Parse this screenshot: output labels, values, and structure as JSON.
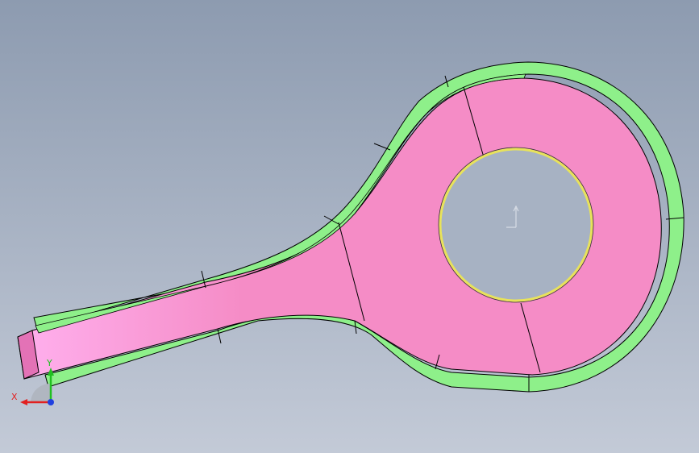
{
  "viewport": {
    "background_top": "#8d9bb0",
    "background_bottom": "#c3cad7"
  },
  "part": {
    "face_color": "#f58cc6",
    "face_highlight": "#ffb0ee",
    "side_color": "#e372b6",
    "rim_color": "#8ef08a",
    "rim_shadow": "#5fbf5c",
    "edge_color": "#000000",
    "hole_edge_color": "#e8e35a",
    "hole_fill": "#a7b2c3"
  },
  "center_marker": {
    "color": "#d8dde6",
    "icon": "origin-arrow-icon"
  },
  "triad": {
    "x_label": "X",
    "y_label": "Y",
    "x_color": "#e22020",
    "y_color": "#20c020",
    "z_color": "#2040e0"
  }
}
